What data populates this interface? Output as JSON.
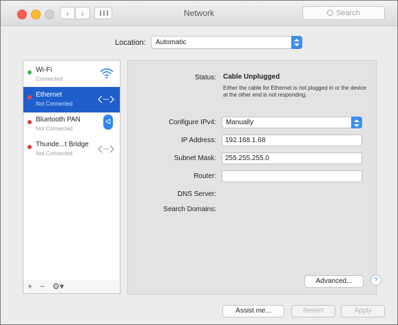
{
  "window": {
    "title": "Network",
    "search_placeholder": "Search"
  },
  "location": {
    "label": "Location:",
    "value": "Automatic"
  },
  "services": [
    {
      "name": "Wi-Fi",
      "status": "Connected",
      "dot_color": "#2bc142",
      "icon": "wifi-icon"
    },
    {
      "name": "Ethernet",
      "status": "Not Connected",
      "dot_color": "#f04a4a",
      "icon": "ethernet-icon"
    },
    {
      "name": "Bluetooth PAN",
      "status": "Not Connected",
      "dot_color": "#e03a3a",
      "icon": "bluetooth-icon"
    },
    {
      "name": "Thunde...t Bridge",
      "status": "Not Connected",
      "dot_color": "#e03a3a",
      "icon": "thunderbolt-bridge-icon"
    }
  ],
  "sidebar_footer": {
    "add": "+",
    "remove": "−",
    "action": "⚙▾"
  },
  "details": {
    "status_label": "Status:",
    "status_value": "Cable Unplugged",
    "status_desc": "Either the cable for Ethernet is not plugged in or the device at the other end is not responding.",
    "configure_label": "Configure IPv4:",
    "configure_value": "Manually",
    "ip_label": "IP Address:",
    "ip_value": "192.168.1.68",
    "subnet_label": "Subnet Mask:",
    "subnet_value": "255.255.255.0",
    "router_label": "Router:",
    "router_value": "",
    "dns_label": "DNS Server:",
    "domains_label": "Search Domains:",
    "advanced_label": "Advanced...",
    "help_label": "?"
  },
  "bottom": {
    "assist": "Assist me...",
    "revert": "Revert",
    "apply": "Apply"
  },
  "colors": {
    "selection": "#1f5fcb",
    "accent": "#3d8df4"
  }
}
